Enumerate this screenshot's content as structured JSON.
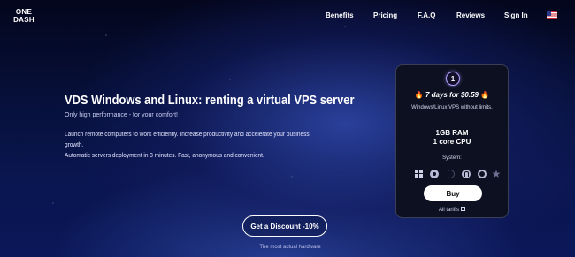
{
  "header": {
    "logo_line1": "ONE",
    "logo_line2": "DASH",
    "nav": {
      "benefits": "Benefits",
      "pricing": "Pricing",
      "faq": "F.A.Q",
      "reviews": "Reviews",
      "signin": "Sign In"
    },
    "language_flag": "us-flag-icon"
  },
  "hero": {
    "title": "VDS Windows and Linux: renting a virtual VPS server",
    "subtitle": "Only high performance - for your comfort!",
    "description_line1": "Launch remote computers to work efficiently. Increase productivity and accelerate your business growth.",
    "description_line2": "Automatic servers deployment in 3 minutes. Fast, anonymous and convenient."
  },
  "cta": {
    "discount_button": "Get a Discount -10%",
    "hardware_note": "The most actual hardware"
  },
  "plan_card": {
    "badge": "1",
    "promo": "7 days for $0.59",
    "os_line": "Windows/Linux VPS without limits.",
    "ram": "1GB RAM",
    "cpu": "1 core CPU",
    "system_label": "System:",
    "systems": [
      "windows-icon",
      "ubuntu-icon",
      "debian-icon",
      "fedora-icon",
      "freebsd-icon",
      "star-icon"
    ],
    "buy_button": "Buy",
    "all_tariffs": "All tariffs"
  },
  "colors": {
    "background_top": "#03061c",
    "background_glow": "#3048aa",
    "card_bg": "#0c1020",
    "card_border": "#3a3f55",
    "badge_glow": "#b6a4ff",
    "fire": "#ff8a2a"
  }
}
